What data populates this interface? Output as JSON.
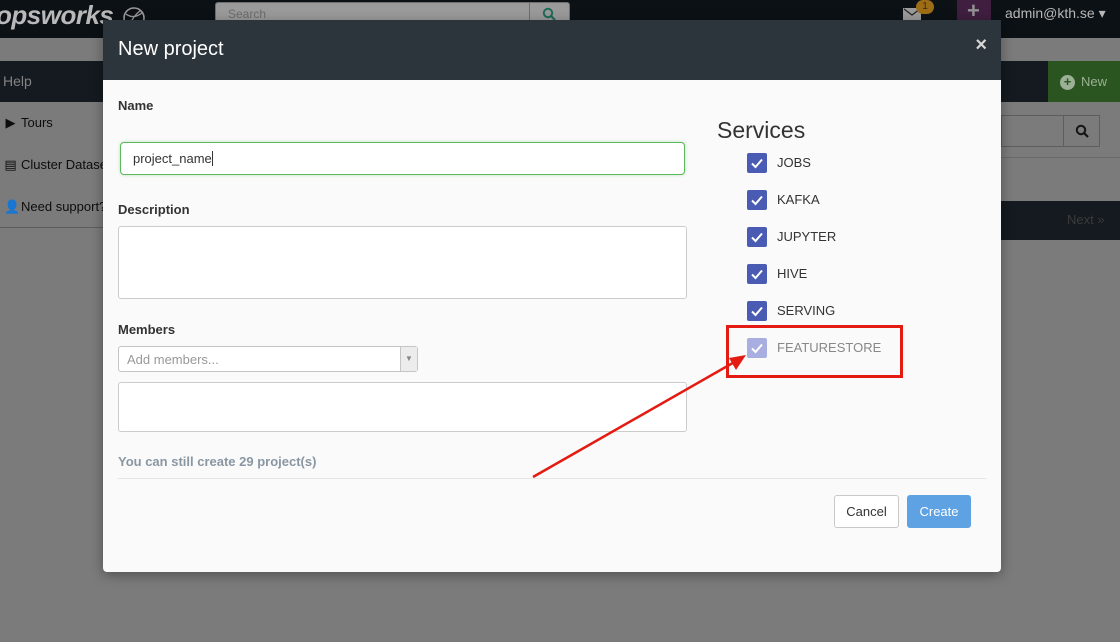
{
  "navbar": {
    "brand": "opsworks",
    "search_placeholder": "Search",
    "mail_badge": "1",
    "user": "admin@kth.se ▾"
  },
  "background": {
    "help_label": "Help",
    "new_button": "New",
    "next_label": "Next »",
    "sidebar": [
      {
        "icon": "caret-right-icon",
        "label": "Tours"
      },
      {
        "icon": "table-icon",
        "label": "Cluster Datase"
      },
      {
        "icon": "user-icon",
        "label": "Need support?"
      }
    ]
  },
  "modal": {
    "title": "New project",
    "close": "×",
    "name_label": "Name",
    "name_value": "project_name",
    "description_label": "Description",
    "members_label": "Members",
    "members_placeholder": "Add members...",
    "quota_text": "You can still create 29 project(s)",
    "services_title": "Services",
    "services": [
      {
        "label": "JOBS",
        "checked": true,
        "disabled": false
      },
      {
        "label": "KAFKA",
        "checked": true,
        "disabled": false
      },
      {
        "label": "JUPYTER",
        "checked": true,
        "disabled": false
      },
      {
        "label": "HIVE",
        "checked": true,
        "disabled": false
      },
      {
        "label": "SERVING",
        "checked": true,
        "disabled": false
      },
      {
        "label": "FEATURESTORE",
        "checked": true,
        "disabled": true
      }
    ],
    "cancel_label": "Cancel",
    "create_label": "Create"
  },
  "colors": {
    "header": "#2d353c",
    "checkbox": "#4a5bb4",
    "checkbox_disabled": "#a8aee0",
    "create_button": "#5ea2e4",
    "annotation": "#e41b12",
    "focus_border": "#5cb85c"
  }
}
